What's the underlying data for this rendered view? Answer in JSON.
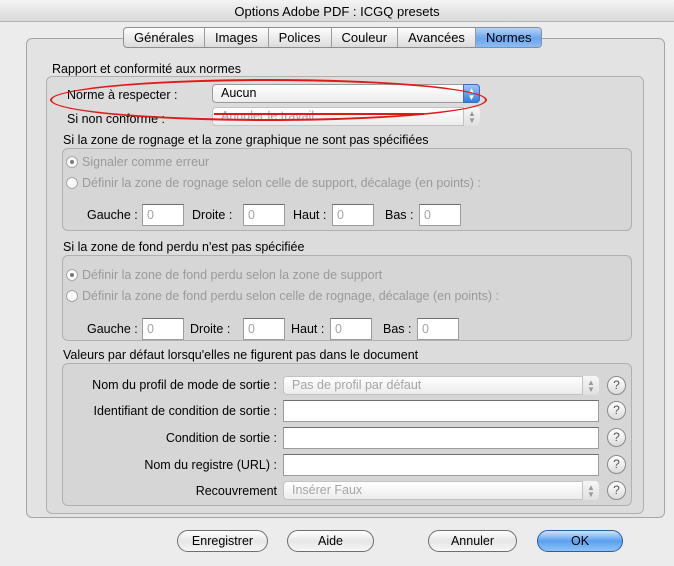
{
  "window": {
    "title": "Options Adobe PDF : ICGQ presets"
  },
  "tabs": [
    {
      "label": "Générales",
      "active": false
    },
    {
      "label": "Images",
      "active": false
    },
    {
      "label": "Polices",
      "active": false
    },
    {
      "label": "Couleur",
      "active": false
    },
    {
      "label": "Avancées",
      "active": false
    },
    {
      "label": "Normes",
      "active": true
    }
  ],
  "compliance": {
    "section_title": "Rapport et conformité aux normes",
    "standard_label": "Norme à respecter :",
    "standard_value": "Aucun",
    "noncompliant_label": "Si non conforme :",
    "noncompliant_value": "Annuler le travail"
  },
  "trim": {
    "section_title": "Si la zone de rognage et la zone graphique ne sont pas spécifiées",
    "option1": "Signaler comme erreur",
    "option2": "Définir la zone de rognage selon celle de support, décalage (en points) :",
    "selected": "option1",
    "left_label": "Gauche :",
    "left_value": "0",
    "right_label": "Droite :",
    "right_value": "0",
    "top_label": "Haut :",
    "top_value": "0",
    "bottom_label": "Bas :",
    "bottom_value": "0"
  },
  "bleed": {
    "section_title": "Si la zone de fond perdu n'est pas spécifiée",
    "option1": "Définir la zone de fond perdu selon la zone de support",
    "option2": "Définir la zone de fond perdu selon celle de rognage, décalage (en points) :",
    "selected": "option1",
    "left_label": "Gauche :",
    "left_value": "0",
    "right_label": "Droite :",
    "right_value": "0",
    "top_label": "Haut :",
    "top_value": "0",
    "bottom_label": "Bas :",
    "bottom_value": "0"
  },
  "defaults": {
    "section_title": "Valeurs par défaut lorsqu'elles ne figurent pas dans le document",
    "output_profile_label": "Nom du profil de mode de sortie :",
    "output_profile_value": "Pas de profil par défaut",
    "output_condition_id_label": "Identifiant de condition de sortie :",
    "output_condition_id_value": "",
    "output_condition_label": "Condition de sortie :",
    "output_condition_value": "",
    "registry_label": "Nom du registre (URL) :",
    "registry_value": "",
    "trapped_label": "Recouvrement",
    "trapped_value": "Insérer Faux",
    "help_glyph": "?"
  },
  "buttons": {
    "save": "Enregistrer",
    "help": "Aide",
    "cancel": "Annuler",
    "ok": "OK"
  },
  "colors": {
    "accent_blue": "#6aa6ee",
    "annotation_red": "#e01919"
  }
}
